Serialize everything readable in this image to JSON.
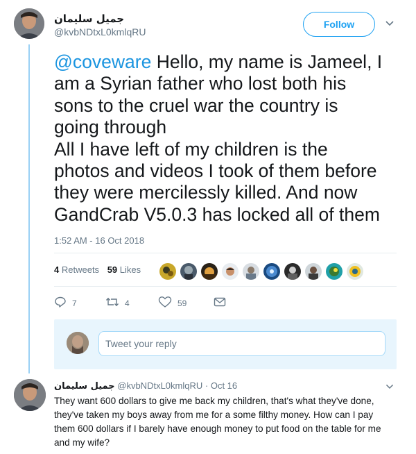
{
  "tweet": {
    "author_name": "جميل سليمان",
    "author_handle": "@kvbNDtxL0kmlqRU",
    "follow_label": "Follow",
    "mention": "@coveware",
    "text_lines": [
      " Hello, my name is Jameel, I",
      "am a Syrian father who lost both his",
      "sons to the cruel war the country is",
      "going through",
      "All I have left of my children is the",
      "photos and videos I took of them before",
      "they were mercilessly killed. And now",
      "GandCrab V5.0.3 has locked all of them"
    ],
    "timestamp": "1:52 AM - 16 Oct 2018",
    "retweets_count": "4",
    "retweets_label": "Retweets",
    "likes_count": "59",
    "likes_label": "Likes",
    "actions": {
      "reply_count": "7",
      "retweet_count": "4",
      "like_count": "59"
    }
  },
  "reply_box": {
    "placeholder": "Tweet your reply"
  },
  "reply": {
    "author_name": "جميل سليمان",
    "author_handle": "@kvbNDtxL0kmlqRU",
    "separator": "·",
    "date": "Oct 16",
    "text_lines": [
      "They want 600 dollars to give me back my children, that's what they've done,",
      "they've taken my boys away from me for a some filthy money. How can I pay",
      "them 600 dollars if I barely have enough money to put food on the table for me",
      "and my wife?"
    ]
  },
  "colors": {
    "accent": "#1da1f2",
    "mention": "#1b95e0",
    "muted": "#657786",
    "thread_line": "#9ad1f5",
    "reply_box_bg": "#e8f5fd"
  },
  "icons": [
    "chevron-down-icon",
    "reply-icon",
    "retweet-icon",
    "heart-icon",
    "envelope-icon"
  ]
}
